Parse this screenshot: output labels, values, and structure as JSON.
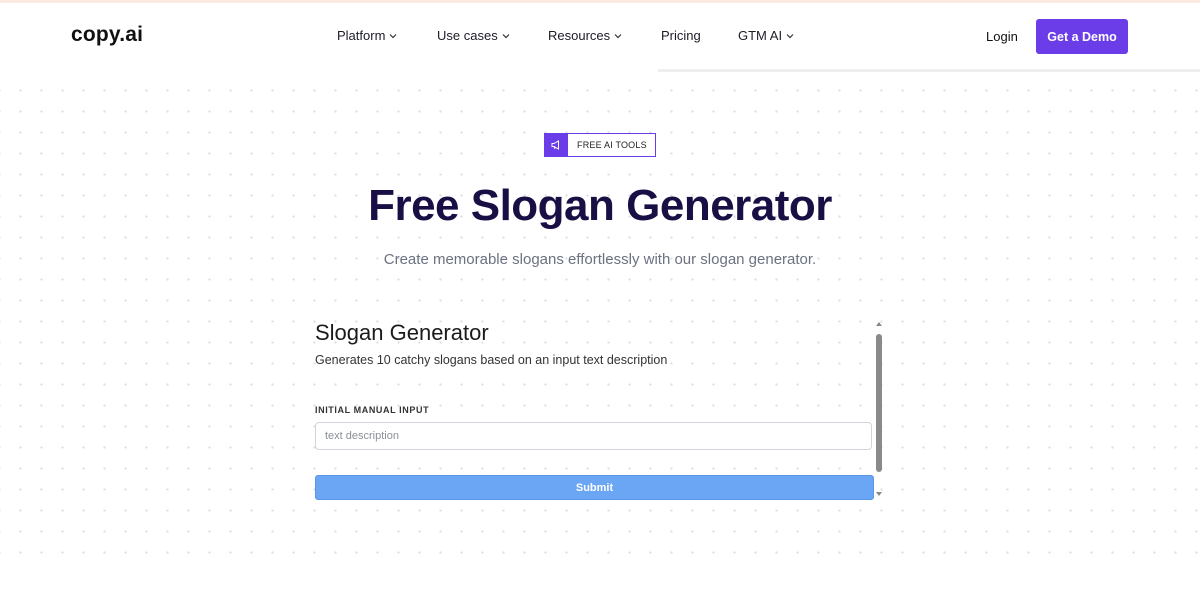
{
  "header": {
    "logo": "copy.ai",
    "nav": [
      {
        "label": "Platform",
        "has_dropdown": true
      },
      {
        "label": "Use cases",
        "has_dropdown": true
      },
      {
        "label": "Resources",
        "has_dropdown": true
      },
      {
        "label": "Pricing",
        "has_dropdown": false
      },
      {
        "label": "GTM AI",
        "has_dropdown": true
      }
    ],
    "login_label": "Login",
    "demo_label": "Get a Demo"
  },
  "hero": {
    "badge_icon": "megaphone-icon",
    "badge_label": "FREE AI TOOLS",
    "title": "Free Slogan Generator",
    "subtitle": "Create memorable slogans effortlessly with our slogan generator."
  },
  "tool": {
    "title": "Slogan Generator",
    "description": "Generates 10 catchy slogans based on an input text description",
    "field_label": "INITIAL MANUAL INPUT",
    "input_value": "",
    "input_placeholder": "text description",
    "submit_label": "Submit"
  },
  "colors": {
    "accent": "#6a3de8",
    "title": "#1a0f45",
    "submit": "#6ba6f5"
  }
}
